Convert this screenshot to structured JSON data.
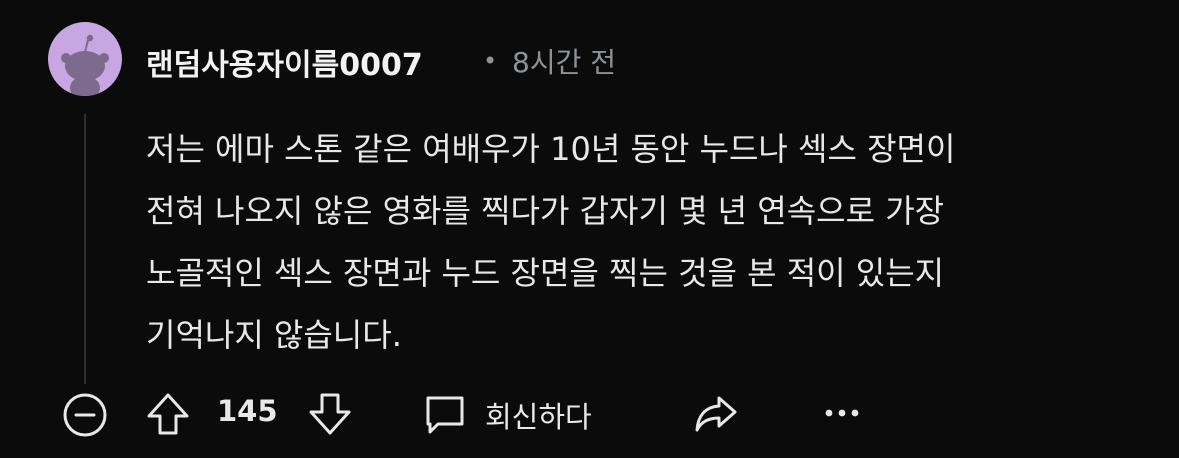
{
  "comment": {
    "username": "랜덤사용자이름0007",
    "separator": "•",
    "time": "8시간 전",
    "body_lines": [
      "저는 에마 스톤 같은 여배우가 10년 동안 누드나 섹스 장면이",
      "전혀 나오지 않은 영화를 찍다가 갑자기 몇 년 연속으로 가장",
      "노골적인 섹스 장면과 누드 장면을 찍는 것을 본 적이 있는지",
      "기억나지 않습니다."
    ]
  },
  "actions": {
    "vote_count": "145",
    "reply_label": "회신하다"
  },
  "icons": {
    "avatar": "reddit-snoo-icon",
    "collapse": "collapse-minus-icon",
    "upvote": "upvote-arrow-icon",
    "downvote": "downvote-arrow-icon",
    "reply": "reply-bubble-icon",
    "share": "share-arrow-icon",
    "more": "more-dots-icon"
  },
  "colors": {
    "background": "#0b0b0b",
    "avatar_bg": "#c8a6e2",
    "text": "#e8e8e8",
    "meta": "#8e9297"
  }
}
